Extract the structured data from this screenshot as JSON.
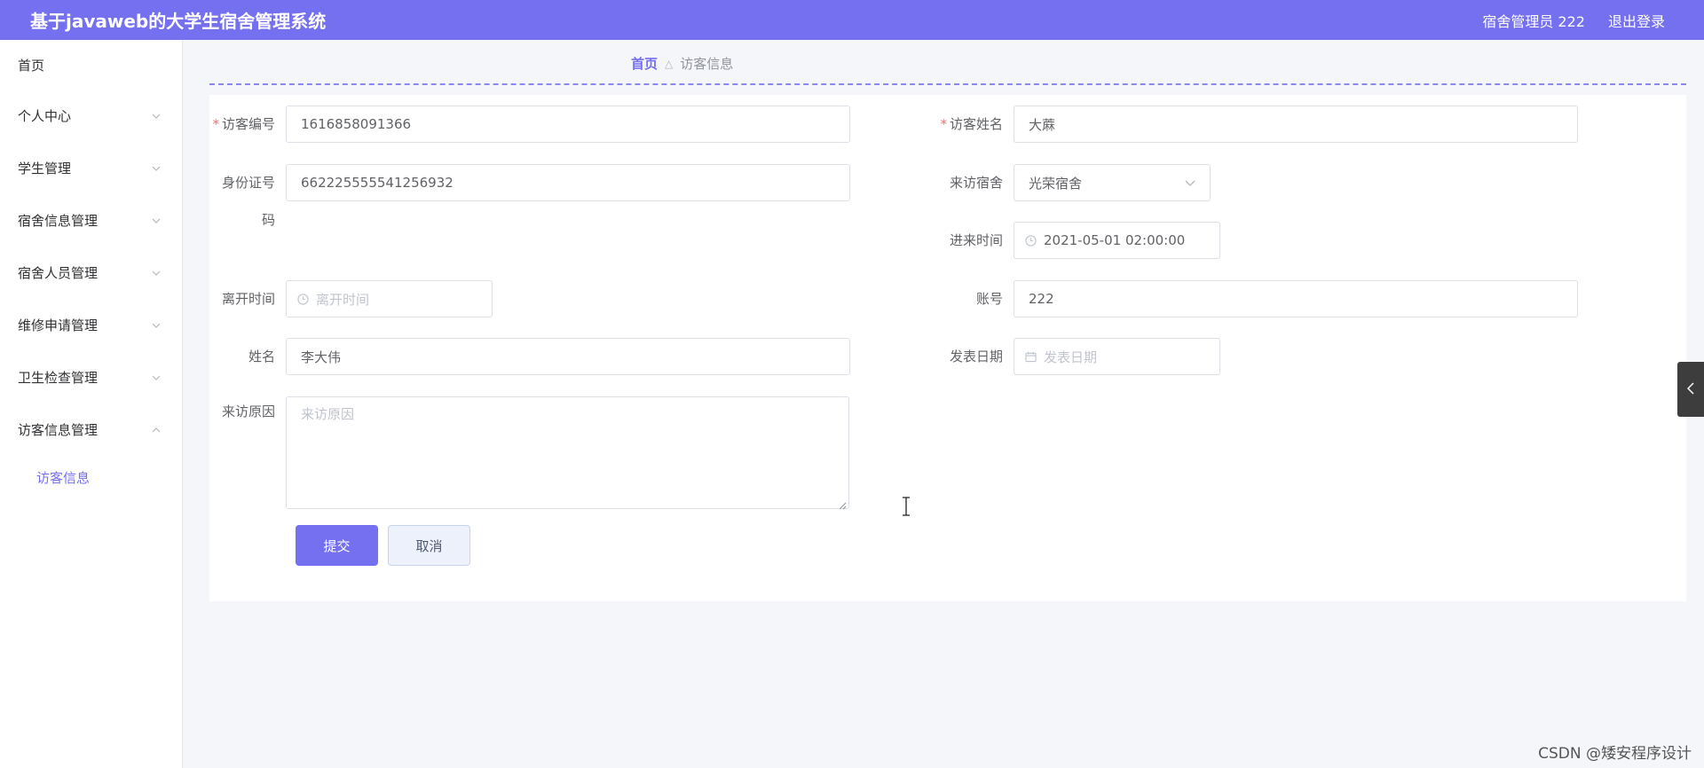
{
  "header": {
    "title": "基于javaweb的大学生宿舍管理系统",
    "user": "宿舍管理员 222",
    "logout": "退出登录"
  },
  "sidebar": {
    "items": [
      {
        "label": "首页"
      },
      {
        "label": "个人中心"
      },
      {
        "label": "学生管理"
      },
      {
        "label": "宿舍信息管理"
      },
      {
        "label": "宿舍人员管理"
      },
      {
        "label": "维修申请管理"
      },
      {
        "label": "卫生检查管理"
      },
      {
        "label": "访客信息管理"
      }
    ],
    "subitem": "访客信息"
  },
  "breadcrumb": {
    "home": "首页",
    "current": "访客信息"
  },
  "form": {
    "visitor_no": {
      "label": "访客编号",
      "value": "1616858091366"
    },
    "visitor_name": {
      "label": "访客姓名",
      "value": "大蔴"
    },
    "id_card": {
      "label_line1": "身份证号",
      "label_line2": "码",
      "value": "662225555541256932"
    },
    "dorm": {
      "label": "来访宿舍",
      "value": "光荣宿舍"
    },
    "enter_time": {
      "label": "进来时间",
      "value": "2021-05-01 02:00:00"
    },
    "leave_time": {
      "label": "离开时间",
      "placeholder": "离开时间"
    },
    "account": {
      "label": "账号",
      "value": "222"
    },
    "name": {
      "label": "姓名",
      "value": "李大伟"
    },
    "publish_date": {
      "label": "发表日期",
      "placeholder": "发表日期"
    },
    "reason": {
      "label": "来访原因",
      "placeholder": "来访原因"
    }
  },
  "buttons": {
    "submit": "提交",
    "cancel": "取消"
  },
  "watermark": "CSDN @矮安程序设计"
}
